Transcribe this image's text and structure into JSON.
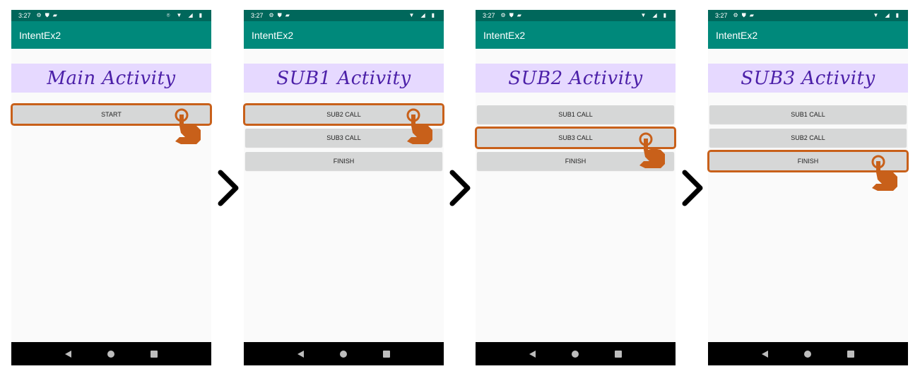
{
  "status_time": "3:27",
  "app_name": "IntentEx2",
  "accent_colors": {
    "status_bar": "#00675b",
    "app_bar": "#00897b",
    "title_band": "#e6d9ff",
    "title_text": "#4b1fa8",
    "highlight": "#c8601a",
    "button": "#d6d7d7"
  },
  "screens": [
    {
      "title": "Main Activity",
      "buttons": [
        "START"
      ]
    },
    {
      "title": "SUB1 Activity",
      "buttons": [
        "SUB2 CALL",
        "SUB3 CALL",
        "FINISH"
      ]
    },
    {
      "title": "SUB2 Activity",
      "buttons": [
        "SUB1 CALL",
        "SUB3 CALL",
        "FINISH"
      ]
    },
    {
      "title": "SUB3 Activity",
      "buttons": [
        "SUB1 CALL",
        "SUB2 CALL",
        "FINISH"
      ]
    }
  ],
  "icons": {
    "status": [
      "gear-icon",
      "shield-icon",
      "sd-card-icon"
    ],
    "status_right": [
      "location-icon",
      "wifi-icon",
      "signal-icon",
      "battery-icon"
    ],
    "nav": [
      "back-icon",
      "home-icon",
      "recent-apps-icon"
    ],
    "step_arrow": "chevron-right-icon",
    "tap": "tap-hand-icon"
  }
}
